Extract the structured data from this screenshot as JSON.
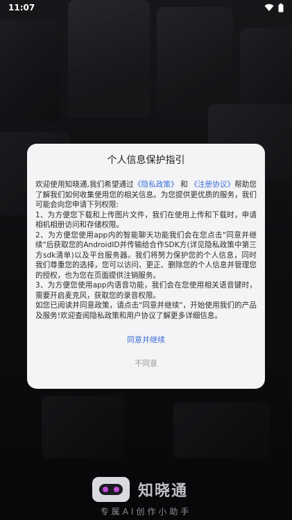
{
  "status_bar": {
    "time": "11:07"
  },
  "dialog": {
    "title": "个人信息保护指引",
    "body": {
      "intro_prefix": "欢迎使用知晓通,我们希望通过",
      "privacy_link": "《隐私政策》",
      "and": "和",
      "register_link": "《注册协议》",
      "intro_suffix": "帮助您了解我们如何收集使用您的相关信息。为您提供更优质的服务，我们可能会向您申请下列权限:",
      "item1": "1、为方便您下载和上传图片文件，我们在使用上传和下载时，申请相机相册访问和存储权限。",
      "item2": "2、为方便您使用app内的智能聊天功能我们会在您点击\"同意并继续\"后获取您的AndroidID并传输给合作SDK方(详见隐私政策中第三方sdk清单)以及平台服务器。我们将努力保护您的个人信息，同时我们尊重您的选择，您可以访问、更正、删除您的个人信息并管理您的授权，也为您在页面提供注销服务。",
      "item3": "3、为方便您使用app内语音功能，我们会在您使用相关语音键时，需要开启麦克风，获取您的录音权限。",
      "closing": "如您已阅读并同意政策，请点击\"同意并继续\"，开始使用我们的产品及服务!欢迎查阅隐私政策和用户协议了解更多详细信息。"
    },
    "agree_label": "同意并继续",
    "disagree_label": "不同意"
  },
  "brand": {
    "app_name": "知晓通",
    "slogan": "专属AI创作小助手"
  },
  "colors": {
    "link": "#3b6fd8",
    "dialog_bg": "#f4f4f6",
    "logo_accent": "#c14bd8"
  },
  "icons": {
    "wifi": "wifi-icon",
    "battery": "battery-icon",
    "logo": "app-logo-icon"
  }
}
